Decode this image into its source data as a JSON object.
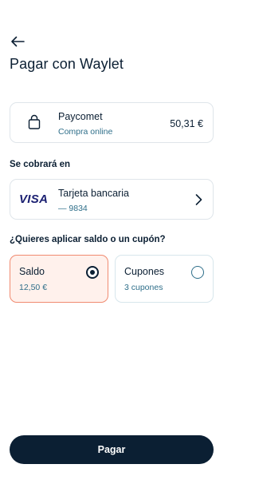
{
  "header": {
    "back_icon": "arrow-left-icon",
    "title": "Pagar con Waylet"
  },
  "merchant": {
    "icon": "shopping-bag-icon",
    "name": "Paycomet",
    "subtitle": "Compra online",
    "amount": "50,31 €"
  },
  "charge_section": {
    "label": "Se cobrará en",
    "card_brand": "VISA",
    "card_name": "Tarjeta bancaria",
    "card_number": "— 9834",
    "chevron_icon": "chevron-right-icon"
  },
  "coupon_section": {
    "question": "¿Quieres aplicar saldo o un cupón?",
    "options": [
      {
        "label": "Saldo",
        "value": "12,50 €",
        "selected": true
      },
      {
        "label": "Cupones",
        "value": "3 cupones",
        "selected": false
      }
    ]
  },
  "footer": {
    "pay_label": "Pagar"
  },
  "colors": {
    "primary": "#0b1f33",
    "secondary_text": "#2f6f8a",
    "selected_bg": "#fff1ec",
    "selected_border": "#f08a70",
    "visa_blue": "#1a1f71"
  }
}
